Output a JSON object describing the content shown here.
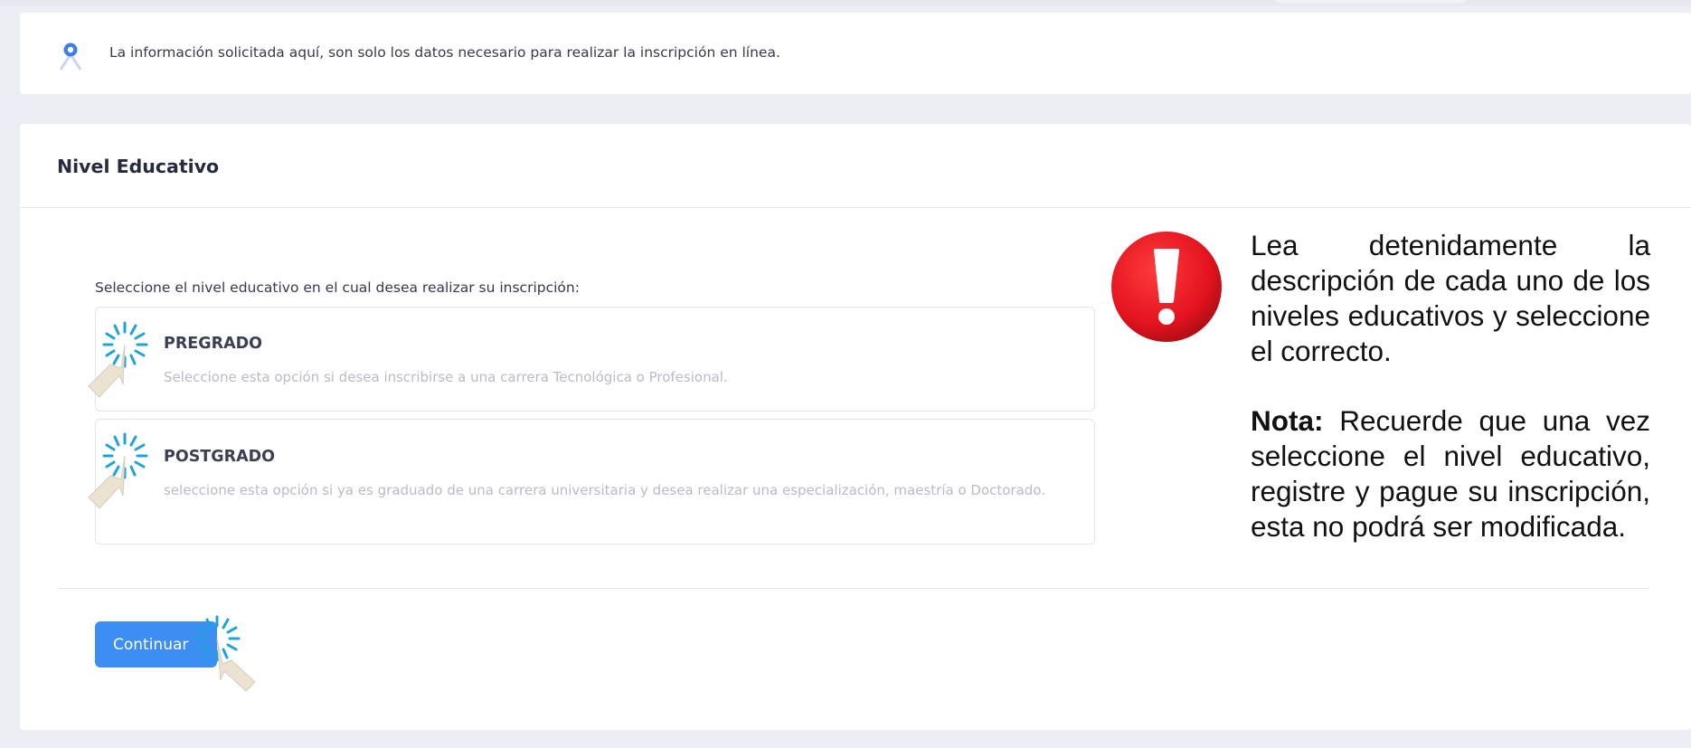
{
  "info": {
    "icon": "location-pin-icon",
    "text": "La información solicitada aquí, son solo los datos necesario para realizar la inscripción en línea."
  },
  "section": {
    "title": "Nivel Educativo",
    "prompt": "Seleccione el nivel educativo en el cual desea realizar su inscripción:"
  },
  "options": [
    {
      "title": "PREGRADO",
      "description": "Seleccione esta opción si desea inscribirse a una carrera Tecnológica o Profesional."
    },
    {
      "title": "POSTGRADO",
      "description": "seleccione esta opción si ya es graduado de una carrera universitaria y desea realizar una especialización, maestría o Doctorado."
    }
  ],
  "button": {
    "continue_label": "Continuar"
  },
  "note": {
    "paragraph1": "Lea detenidamente la descripción de cada uno de los niveles educativos y seleccione el correcto.",
    "label": "Nota:",
    "paragraph2": " Recuerde que una vez seleccione el nivel educativo, registre y pague su inscripción, esta no podrá ser modificada."
  },
  "colors": {
    "primary": "#3d8ef2",
    "alert_red": "#e3131f",
    "click_effect": "#1fa3d8"
  }
}
